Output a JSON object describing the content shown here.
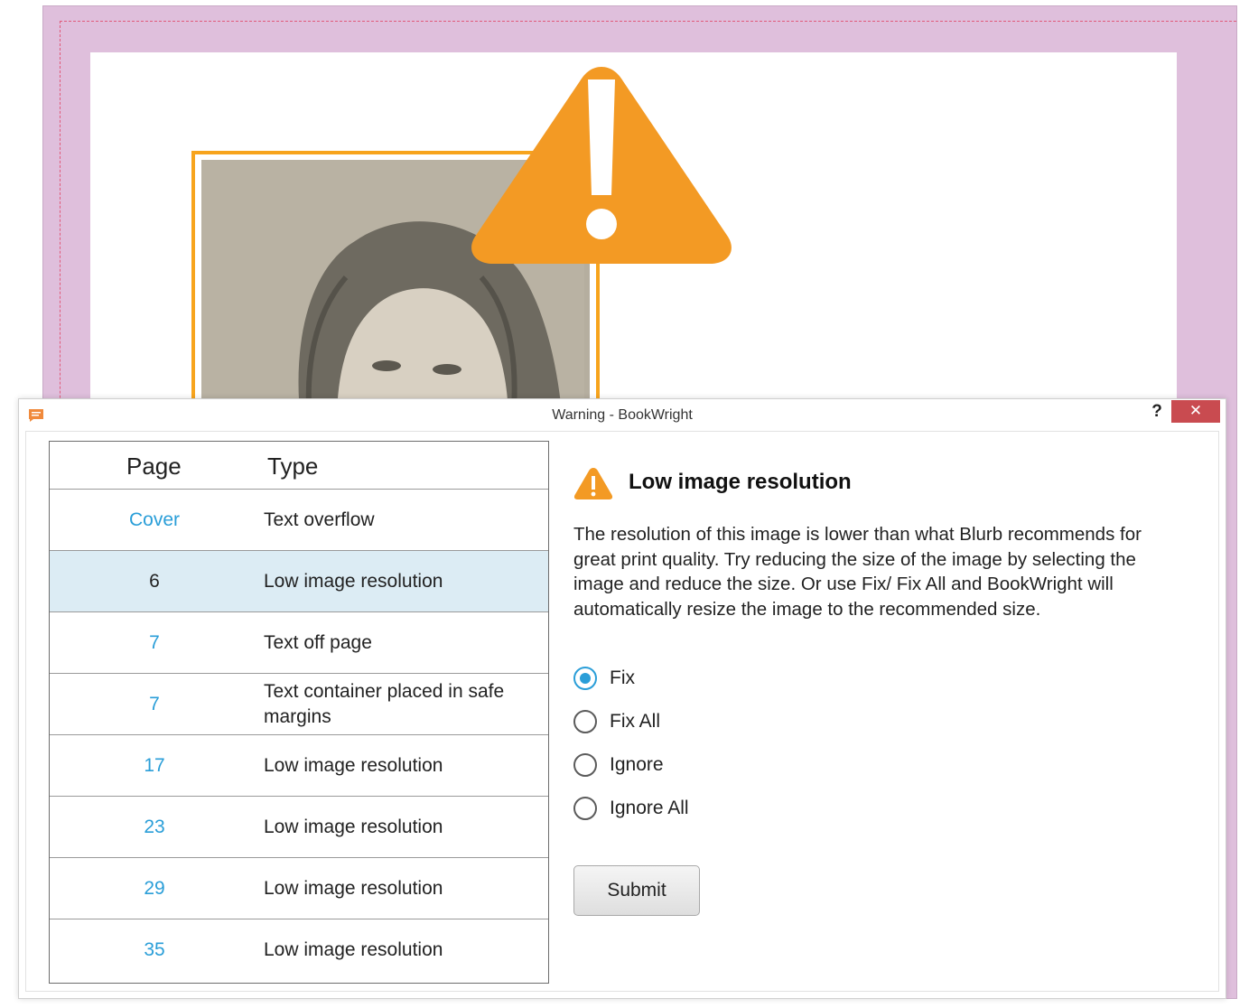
{
  "dialog": {
    "title": "Warning - BookWright",
    "help_label": "?",
    "close_label": "✕"
  },
  "table": {
    "headers": {
      "page": "Page",
      "type": "Type"
    },
    "rows": [
      {
        "page": "Cover",
        "type": "Text overflow",
        "selected": false
      },
      {
        "page": "6",
        "type": "Low image resolution",
        "selected": true
      },
      {
        "page": "7",
        "type": "Text off page",
        "selected": false
      },
      {
        "page": "7",
        "type": "Text container placed in safe margins",
        "selected": false
      },
      {
        "page": "17",
        "type": "Low image resolution",
        "selected": false
      },
      {
        "page": "23",
        "type": "Low image resolution",
        "selected": false
      },
      {
        "page": "29",
        "type": "Low image resolution",
        "selected": false
      },
      {
        "page": "35",
        "type": "Low image resolution",
        "selected": false
      }
    ]
  },
  "details": {
    "title": "Low image resolution",
    "description": "The resolution of this image is lower than what Blurb recommends for great print quality. Try reducing the size of the image by selecting the image and reduce the size. Or use Fix/ Fix All and BookWright will automatically resize the image to the recommended size.",
    "options": [
      {
        "label": "Fix",
        "checked": true
      },
      {
        "label": "Fix All",
        "checked": false
      },
      {
        "label": "Ignore",
        "checked": false
      },
      {
        "label": "Ignore All",
        "checked": false
      }
    ],
    "submit_label": "Submit"
  },
  "colors": {
    "warning_orange": "#f39a24",
    "link_blue": "#2a9ed8",
    "selected_row": "#dcecf4",
    "close_red": "#c94b50",
    "page_bleed": "#dfbfdc"
  },
  "icons": {
    "warning": "warning-triangle-icon",
    "app": "bookwright-app-icon",
    "close": "close-icon",
    "help": "help-icon"
  }
}
